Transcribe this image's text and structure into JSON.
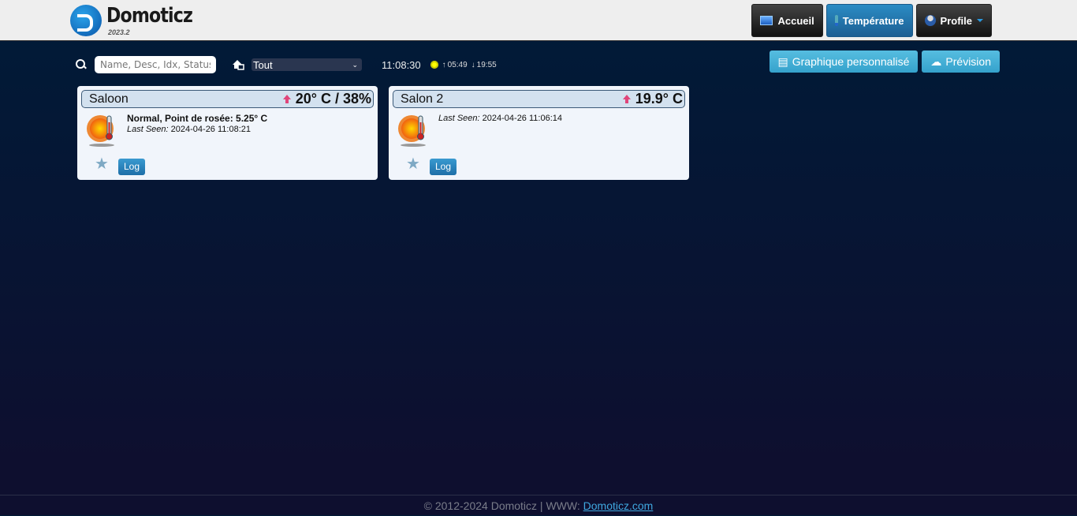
{
  "header": {
    "logo_text": "Domoticz",
    "version": "2023.2",
    "nav": [
      {
        "label": "Accueil",
        "icon": "dashboard-icon"
      },
      {
        "label": "Température",
        "icon": "thermometer-icon",
        "active": true
      },
      {
        "label": "Profile",
        "icon": "profile-icon"
      }
    ]
  },
  "toolbar": {
    "search_placeholder": "Name, Desc, Idx, Status",
    "room_select": "Tout",
    "time": "11:08:30",
    "sunrise": "05:49",
    "sunset": "19:55"
  },
  "actions": {
    "custom_graph": "Graphique personnalisé",
    "forecast": "Prévision"
  },
  "devices": [
    {
      "name": "Saloon",
      "value": "20° C / 38%",
      "status": "Normal, Point de rosée: 5.25° C",
      "last_seen_label": "Last Seen:",
      "last_seen": "2024-04-26 11:08:21",
      "log": "Log"
    },
    {
      "name": "Salon 2",
      "value": "19.9° C",
      "status": "",
      "last_seen_label": "Last Seen:",
      "last_seen": "2024-04-26 11:06:14",
      "log": "Log"
    }
  ],
  "footer": {
    "text": "© 2012-2024 Domoticz | WWW: ",
    "link": "Domoticz.com"
  },
  "colors": {
    "accent": "#2b8cc4",
    "trend_up": "#e0457a"
  }
}
